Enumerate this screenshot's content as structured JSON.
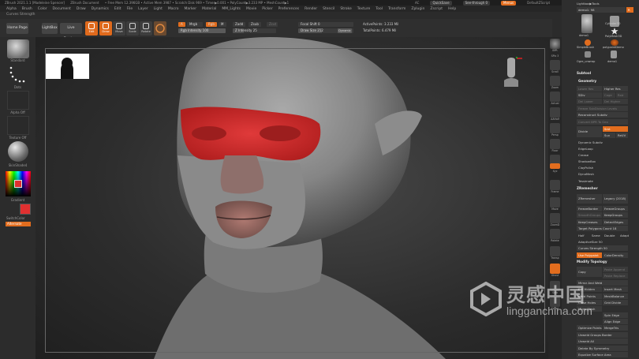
{
  "title_bar": {
    "app": "ZBrush 2021.1.1 [Madeleine Spencer]",
    "document": "ZBrush Document",
    "stats": "• Free Mem 12.396GB • Active Mem 3987 • Scratch Disk 969 • Timer▶0.001 • PolyCount▶3.233 MP • MeshCount▶1",
    "ac": "AC",
    "quicksave": "QuickSave",
    "seethrough": "See-through  0",
    "menus": "Menus",
    "script": "DefaultZScript"
  },
  "menu": [
    "Alpha",
    "Brush",
    "Color",
    "Document",
    "Draw",
    "Dynamics",
    "Edit",
    "File",
    "Layer",
    "Light",
    "Macro",
    "Marker",
    "Material",
    "MM_Lights",
    "Movie",
    "Picker",
    "Preferences",
    "Render",
    "Stencil",
    "Stroke",
    "Texture",
    "Tool",
    "Transform",
    "Zplugin",
    "Zscript",
    "Help"
  ],
  "tool_label": "Curves Strength",
  "shelf": {
    "home": "Home Page",
    "lightbox": "LightBox",
    "live_boolean": "Live Boolean",
    "tools": [
      {
        "label": "Edit",
        "icon": "edit-icon",
        "active": true
      },
      {
        "label": "Draw",
        "icon": "draw-icon",
        "active": true
      },
      {
        "label": "Move",
        "icon": "move-icon",
        "active": false
      },
      {
        "label": "Scale",
        "icon": "scale-icon",
        "active": false
      },
      {
        "label": "Rotate",
        "icon": "rotate-icon",
        "active": false
      }
    ],
    "mrgb": "A",
    "rgb": "Mrgb",
    "rgb_intensity": "Rgb Intensity 100",
    "m": "M",
    "zadd": "Zadd",
    "zsub": "Zsub",
    "zcut": "Zcut",
    "z_intensity": "Z Intensity 25",
    "rgb_btn": "Rgb",
    "focal_shift": "Focal Shift 0",
    "draw_size": "Draw Size 212",
    "dynamic": "Dynamic",
    "active_points": "ActivePoints: 3.233 Mil",
    "total_points": "TotalPoints: 6.479 Mil"
  },
  "left_shelf": {
    "brush": "Standard",
    "stroke": "Dots",
    "alpha": "Alpha Off",
    "texture": "Texture Off",
    "material": "SkinShade4",
    "gradient": "Gradient",
    "switch_color": "SwitchColor",
    "alternate": "Alternate",
    "main_color": "#e03030"
  },
  "right_tray": [
    "BPR",
    "SPix 3",
    "Scroll",
    "Zoom",
    "Actual",
    "AAHalf",
    "Persp",
    "Floor",
    "L.Sym",
    "Xyz",
    "Frame",
    "Move",
    "ZoomD",
    "Rotate",
    "Transp",
    "Ghost",
    "Solo",
    "Xpose"
  ],
  "right_panel": {
    "lightbox_tools": "Lightbox▶Tools",
    "tool_name": "demo1: 98",
    "r_label": "R",
    "subtools": [
      "demo1",
      "Cylinder3D",
      "PolyMesh3D",
      "SimpleBrush",
      "polypaintDemo",
      "Ogre_unwrap",
      "demo1"
    ],
    "subtool_header": "Subtool",
    "geometry_header": "Geometry",
    "lower_res": "Lower Res",
    "higher_res": "Higher Res",
    "sdiv": "SDiv",
    "cage": "Cage",
    "rstr": "Rstr",
    "del_lower": "Del Lower",
    "del_higher": "Del Higher",
    "freeze_sub": "Freeze SubDivision Levels",
    "reconstruct": "Reconstruct Subdiv",
    "convert_bpr": "Convert BPR To Geo",
    "divide": "Divide",
    "smt": "Smt",
    "suv": "Suv",
    "reuv": "ReUV",
    "dynamic_subdiv": "Dynamic Subdiv",
    "edgeloop": "EdgeLoop",
    "crease": "Crease",
    "shadowbox": "ShadowBox",
    "claypolish": "ClayPolish",
    "dynamesh": "DynaMesh",
    "tessimate": "Tessimate",
    "zremesher_header": "ZRemesher",
    "zremesher": "ZRemesher",
    "legacy": "Legacy (2018)",
    "freezeborder": "FreezeBorder",
    "freezegroups": "FreezeGroups",
    "smoothgroups": "SmoothGroups",
    "keepgroups": "KeepGroups",
    "keepcreases": "KeepCreases",
    "detectedges": "DetectEdges",
    "target_polycount": "Target Polygons Count 18",
    "half": "Half",
    "same": "Same",
    "double": "Double",
    "adapt": "Adapt",
    "adaptive_size": "AdaptiveSize 50",
    "curves_strength": "Curves Strength 50",
    "use_polypaint": "Use Polypaint",
    "color_density": "ColorDensity",
    "modify_topology": "Modify Topology",
    "copy": "Copy",
    "paste_append": "Paste Append",
    "paste_replace": "Paste Replace",
    "mirror_and_weld": "Mirror And Weld",
    "del_hidden": "Del Hidden",
    "insert_mesh": "Insert Mesh",
    "weld_points": "Weld Points",
    "meshblanck": "MeshBalance",
    "close_holes": "Close Holes",
    "grid_divide": "Grid Divide",
    "micro_mesh": "Micro Mesh",
    "spin_edge": "Spin Edge",
    "align_edge": "Align Edge",
    "optimize_points": "Optimize Points",
    "mergetris": "MergeTris",
    "unweld_groups_border": "Unweld Groups Border",
    "unweld_all": "Unweld All",
    "delete_by_symmetry": "Delete By Symmetry",
    "equalize_surface": "Equalize Surface Area"
  },
  "watermark": {
    "cn": "灵感中国",
    "url": "lingganchina.com"
  }
}
